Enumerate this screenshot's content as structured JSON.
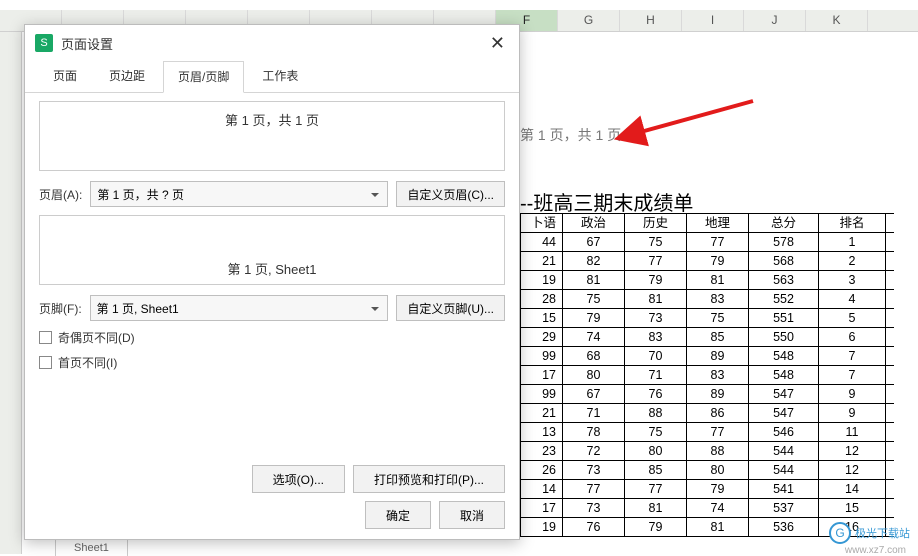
{
  "dialog": {
    "app_icon_letter": "S",
    "title": "页面设置",
    "tabs": [
      "页面",
      "页边距",
      "页眉/页脚",
      "工作表"
    ],
    "active_tab": 2,
    "header_preview": "第 1 页，共 1 页",
    "header_label": "页眉(A):",
    "header_combo_value": "第 1 页，共 ? 页",
    "custom_header_btn": "自定义页眉(C)...",
    "footer_preview": "第 1 页, Sheet1",
    "footer_label": "页脚(F):",
    "footer_combo_value": "第 1 页, Sheet1",
    "custom_footer_btn": "自定义页脚(U)...",
    "chk_odd_even": "奇偶页不同(D)",
    "chk_first_page": "首页不同(I)",
    "options_btn": "选项(O)...",
    "print_preview_btn": "打印预览和打印(P)...",
    "ok_btn": "确定",
    "cancel_btn": "取消"
  },
  "spreadsheet": {
    "col_headers": [
      "",
      "",
      "",
      "",
      "",
      "",
      "",
      "",
      "F",
      "G",
      "H",
      "I",
      "J",
      "K"
    ],
    "selected_col_index": 8,
    "page_header_text": "第 1 页，共 1 页",
    "title": "--班高三期末成绩单",
    "columns": [
      "卜语",
      "政治",
      "历史",
      "地理",
      "总分",
      "排名"
    ],
    "rows": [
      [
        44,
        67,
        75,
        77,
        578,
        1
      ],
      [
        21,
        82,
        77,
        79,
        568,
        2
      ],
      [
        19,
        81,
        79,
        81,
        563,
        3
      ],
      [
        28,
        75,
        81,
        83,
        552,
        4
      ],
      [
        15,
        79,
        73,
        75,
        551,
        5
      ],
      [
        29,
        74,
        83,
        85,
        550,
        6
      ],
      [
        99,
        68,
        70,
        89,
        548,
        7
      ],
      [
        17,
        80,
        71,
        83,
        548,
        7
      ],
      [
        99,
        67,
        76,
        89,
        547,
        9
      ],
      [
        21,
        71,
        88,
        86,
        547,
        9
      ],
      [
        13,
        78,
        75,
        77,
        546,
        11
      ],
      [
        23,
        72,
        80,
        88,
        544,
        12
      ],
      [
        26,
        73,
        85,
        80,
        544,
        12
      ],
      [
        14,
        77,
        77,
        79,
        541,
        14
      ],
      [
        17,
        73,
        81,
        74,
        537,
        15
      ],
      [
        19,
        76,
        79,
        81,
        536,
        16
      ]
    ],
    "sheet_tab": "Sheet1"
  },
  "watermark": {
    "text": "极光下载站",
    "url": "www.xz7.com",
    "icon": "G"
  },
  "colors": {
    "accent_green": "#19a865",
    "arrow_red": "#e21b1b"
  }
}
